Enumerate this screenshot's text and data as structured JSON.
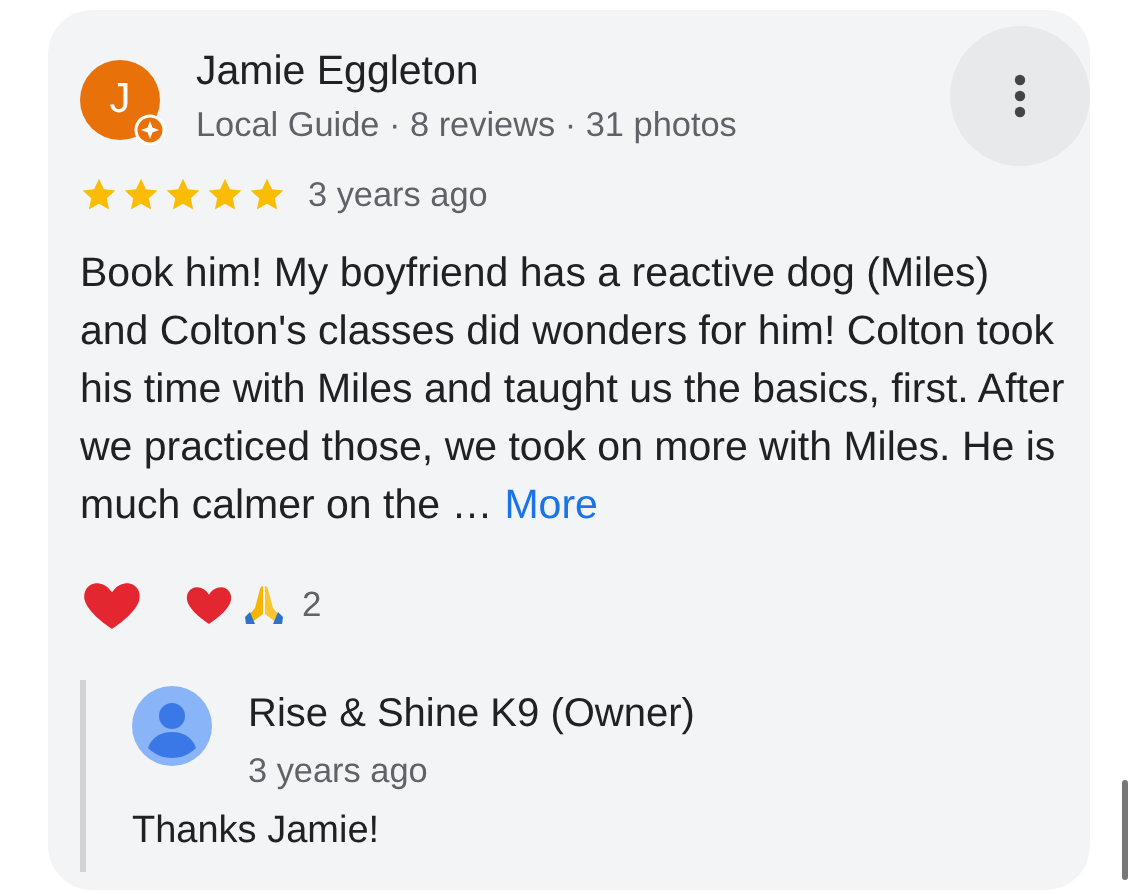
{
  "review": {
    "author": {
      "initial": "J",
      "name": "Jamie Eggleton",
      "local_guide": true,
      "subtitle": "Local Guide · 8 reviews · 31 photos"
    },
    "rating": {
      "stars": 5
    },
    "time": "3 years ago",
    "text": "Book him! My boyfriend has a reactive dog (Miles) and Colton's classes did wonders for him! Colton took his time with Miles and taught us the basics, first. After we practiced those, we took on more with Miles. He is much calmer on the …",
    "more_link": "More",
    "reactions": {
      "liked": false,
      "count": "2"
    },
    "owner_reply": {
      "author": "Rise & Shine K9 (Owner)",
      "time": "3 years ago",
      "text": "Thanks Jamie!"
    }
  }
}
